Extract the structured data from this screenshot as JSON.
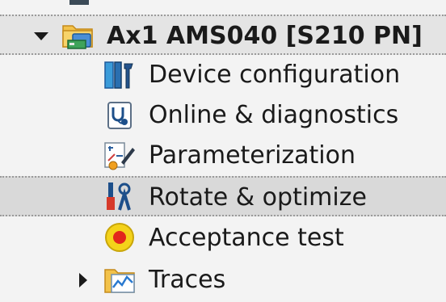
{
  "tree": {
    "root": {
      "label": "Ax1 AMS040 [S210 PN]",
      "expanded": true
    },
    "children": [
      {
        "label": "Device configuration",
        "icon": "device-config-icon"
      },
      {
        "label": "Online & diagnostics",
        "icon": "diagnostics-icon"
      },
      {
        "label": "Parameterization",
        "icon": "parameterization-icon"
      },
      {
        "label": "Rotate & optimize",
        "icon": "tools-icon",
        "selected": true
      },
      {
        "label": "Acceptance test",
        "icon": "acceptance-test-icon"
      },
      {
        "label": "Traces",
        "icon": "trace-folder-icon",
        "expanded": false
      }
    ]
  }
}
